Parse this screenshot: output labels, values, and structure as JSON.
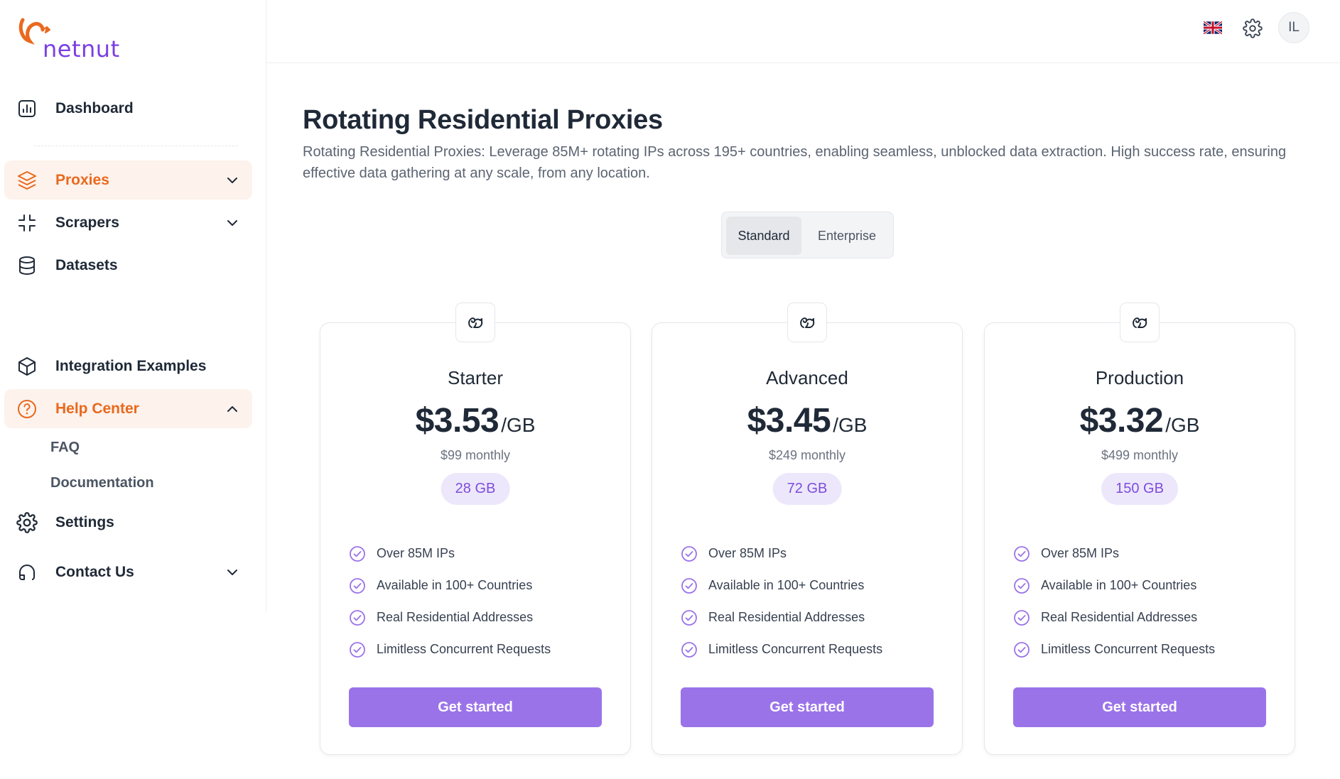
{
  "brand": {
    "logo_text": "netnut",
    "accent": "#e9691e",
    "purple": "#9b73e9"
  },
  "sidebar": {
    "items": [
      {
        "label": "Dashboard"
      },
      {
        "label": "Proxies"
      },
      {
        "label": "Scrapers"
      },
      {
        "label": "Datasets"
      },
      {
        "label": "Integration Examples"
      },
      {
        "label": "Help Center"
      },
      {
        "label": "Settings"
      },
      {
        "label": "Contact Us"
      }
    ],
    "help_sub": [
      {
        "label": "FAQ"
      },
      {
        "label": "Documentation"
      }
    ]
  },
  "header": {
    "avatar_initials": "IL",
    "flag": "uk-flag-icon",
    "settings_icon": "gear-icon"
  },
  "main": {
    "title": "Rotating Residential Proxies",
    "description": "Rotating Residential Proxies: Leverage 85M+ rotating IPs across 195+ countries, enabling seamless, unblocked data extraction. High success rate, ensuring effective data gathering at any scale, from any location.",
    "toggle": {
      "standard": "Standard",
      "enterprise": "Enterprise",
      "selected": "Standard"
    }
  },
  "plans": [
    {
      "name": "Starter",
      "price": "$3.53",
      "unit": "/GB",
      "monthly": "$99 monthly",
      "gb": "28 GB",
      "features": [
        "Over 85M IPs",
        "Available in 100+ Countries",
        "Real Residential Addresses",
        "Limitless Concurrent Requests"
      ],
      "cta": "Get started"
    },
    {
      "name": "Advanced",
      "price": "$3.45",
      "unit": "/GB",
      "monthly": "$249 monthly",
      "gb": "72 GB",
      "features": [
        "Over 85M IPs",
        "Available in 100+ Countries",
        "Real Residential Addresses",
        "Limitless Concurrent Requests"
      ],
      "cta": "Get started"
    },
    {
      "name": "Production",
      "price": "$3.32",
      "unit": "/GB",
      "monthly": "$499 monthly",
      "gb": "150 GB",
      "features": [
        "Over 85M IPs",
        "Available in 100+ Countries",
        "Real Residential Addresses",
        "Limitless Concurrent Requests"
      ],
      "cta": "Get started"
    }
  ]
}
